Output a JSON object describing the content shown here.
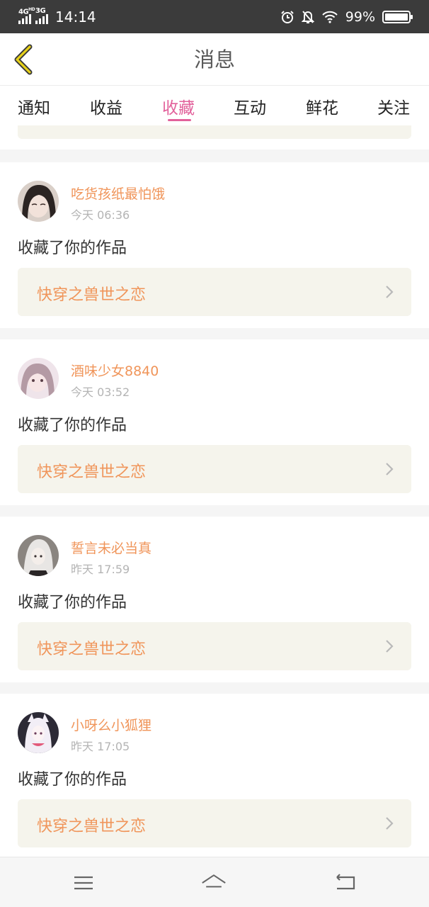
{
  "status_bar": {
    "network_1": "4G",
    "network_1_sup": "HD",
    "network_2": "3G",
    "time": "14:14",
    "battery": "99%",
    "icons": [
      "alarm-icon",
      "bell-off-icon",
      "wifi-icon",
      "battery-icon"
    ]
  },
  "header": {
    "title": "消息",
    "back_icon": "chevron-left-icon"
  },
  "tabs": [
    {
      "label": "通知",
      "active": false
    },
    {
      "label": "收益",
      "active": false
    },
    {
      "label": "收藏",
      "active": true
    },
    {
      "label": "互动",
      "active": false
    },
    {
      "label": "鲜花",
      "active": false
    },
    {
      "label": "关注",
      "active": false
    }
  ],
  "messages": [
    {
      "user": "吃货孩纸最怕饿",
      "time": "今天 06:36",
      "action": "收藏了你的作品",
      "work": "快穿之兽世之恋"
    },
    {
      "user": "酒味少女8840",
      "time": "今天 03:52",
      "action": "收藏了你的作品",
      "work": "快穿之兽世之恋"
    },
    {
      "user": "誓言未必当真",
      "time": "昨天 17:59",
      "action": "收藏了你的作品",
      "work": "快穿之兽世之恋"
    },
    {
      "user": "小呀么小狐狸",
      "time": "昨天 17:05",
      "action": "收藏了你的作品",
      "work": "快穿之兽世之恋"
    }
  ],
  "bottom_nav": {
    "icons": [
      "menu-icon",
      "home-icon",
      "back-icon"
    ]
  },
  "colors": {
    "accent_pink": "#e2619b",
    "username_orange": "#f0955a",
    "work_box_bg": "#f5f4ec",
    "status_bar_bg": "#3b3b3b",
    "back_arrow": "#d9b800"
  }
}
